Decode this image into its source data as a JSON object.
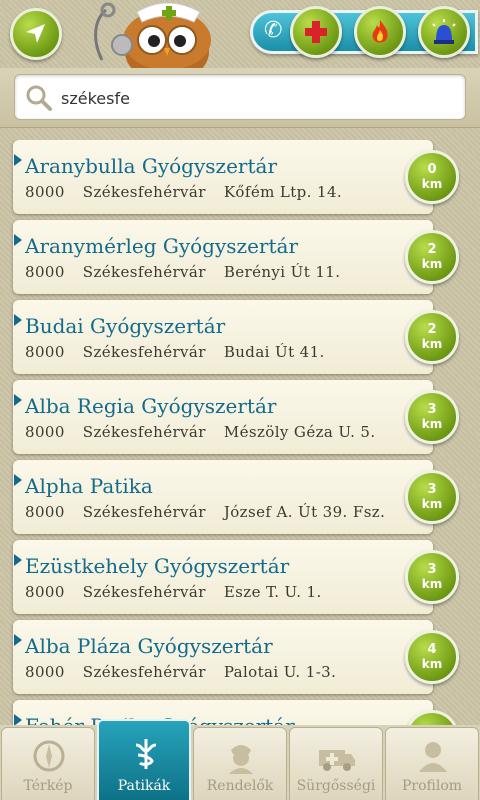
{
  "search": {
    "value": "székesfe",
    "placeholder": ""
  },
  "pharmacies": [
    {
      "name": "Aranybulla Gyógyszertár",
      "zip": "8000",
      "city": "Székesfehérvár",
      "street": "Kőfém Ltp. 14.",
      "distance": "0",
      "unit": "km"
    },
    {
      "name": "Aranymérleg Gyógyszertár",
      "zip": "8000",
      "city": "Székesfehérvár",
      "street": "Berényi Út 11.",
      "distance": "2",
      "unit": "km"
    },
    {
      "name": "Budai Gyógyszertár",
      "zip": "8000",
      "city": "Székesfehérvár",
      "street": "Budai Út 41.",
      "distance": "2",
      "unit": "km"
    },
    {
      "name": "Alba Regia Gyógyszertár",
      "zip": "8000",
      "city": "Székesfehérvár",
      "street": "Mészöly Géza U. 5.",
      "distance": "3",
      "unit": "km"
    },
    {
      "name": "Alpha Patika",
      "zip": "8000",
      "city": "Székesfehérvár",
      "street": "József A. Út 39. Fsz.",
      "distance": "3",
      "unit": "km"
    },
    {
      "name": "Ezüstkehely Gyógyszertár",
      "zip": "8000",
      "city": "Székesfehérvár",
      "street": "Esze T. U. 1.",
      "distance": "3",
      "unit": "km"
    },
    {
      "name": "Alba Pláza Gyógyszertár",
      "zip": "8000",
      "city": "Székesfehérvár",
      "street": "Palotai U. 1-3.",
      "distance": "4",
      "unit": "km"
    },
    {
      "name": "Fehér Patika Gyógyszertár",
      "zip": "",
      "city": "",
      "street": "",
      "distance": "",
      "unit": ""
    }
  ],
  "tabs": [
    {
      "label": "Térkép",
      "icon": "compass-icon",
      "active": false
    },
    {
      "label": "Patikák",
      "icon": "caduceus-icon",
      "active": true
    },
    {
      "label": "Rendelők",
      "icon": "nurse-icon",
      "active": false
    },
    {
      "label": "Sürgősségi",
      "icon": "ambulance-icon",
      "active": false
    },
    {
      "label": "Profilom",
      "icon": "profile-icon",
      "active": false
    }
  ],
  "colors": {
    "accent_green": "#7aa61a",
    "title_teal": "#126b8c",
    "tab_active": "#1b8fa8",
    "emergency_red": "#d8232a"
  }
}
